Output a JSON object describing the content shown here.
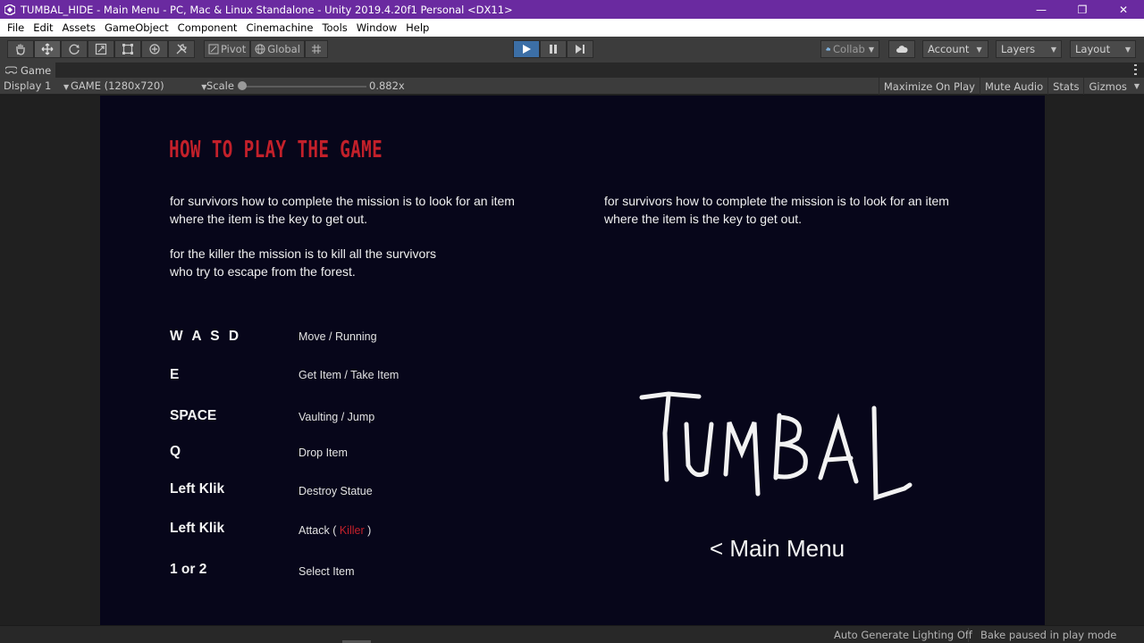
{
  "window": {
    "title": "TUMBAL_HIDE - Main Menu - PC, Mac & Linux Standalone - Unity 2019.4.20f1 Personal <DX11>",
    "minimize_glyph": "—",
    "maximize_glyph": "❐",
    "close_glyph": "✕"
  },
  "menu": [
    "File",
    "Edit",
    "Assets",
    "GameObject",
    "Component",
    "Cinemachine",
    "Tools",
    "Window",
    "Help"
  ],
  "toolbar": {
    "pivot_label": "Pivot",
    "global_label": "Global",
    "collab_label": "Collab",
    "account_label": "Account",
    "layers_label": "Layers",
    "layout_label": "Layout"
  },
  "tab": {
    "label": "Game"
  },
  "gamebar": {
    "display": "Display 1",
    "resolution": "GAME (1280x720)",
    "scale_label": "Scale",
    "scale_value": "0.882x",
    "scale_fraction": 0.0,
    "maximize_on_play": "Maximize On Play",
    "mute_audio": "Mute Audio",
    "stats": "Stats",
    "gizmos": "Gizmos"
  },
  "game": {
    "heading": "HOW TO PLAY THE GAME",
    "survivors_line1": "for survivors how to complete the mission is to look for an item",
    "survivors_line2": "where the item is the key to get out.",
    "killer_line1": "for the killer the mission is to kill all the survivors",
    "killer_line2": "who try to escape from the forest.",
    "right_line1": "for survivors how to complete the mission is to look for an item",
    "right_line2": "where the item is the key to get out.",
    "controls": [
      {
        "key": "W A S D",
        "action": "Move / Running"
      },
      {
        "key": "E",
        "action": "Get Item / Take Item"
      },
      {
        "key": "SPACE",
        "action": "Vaulting / Jump"
      },
      {
        "key": "Q",
        "action": "Drop Item"
      },
      {
        "key": "Left Klik",
        "action": "Destroy Statue"
      },
      {
        "key": "Left Klik",
        "action_prefix": "Attack ( ",
        "action_highlight": "Killer",
        "action_suffix": " )"
      },
      {
        "key": "1 or 2",
        "action": "Select Item"
      }
    ],
    "logo_text": "TUMBAL",
    "main_menu_label": "< Main Menu",
    "accent_color": "#c3202a",
    "background_color": "#07061a"
  },
  "status": {
    "lighting": "Auto Generate Lighting Off",
    "bake": "Bake paused in play mode"
  }
}
